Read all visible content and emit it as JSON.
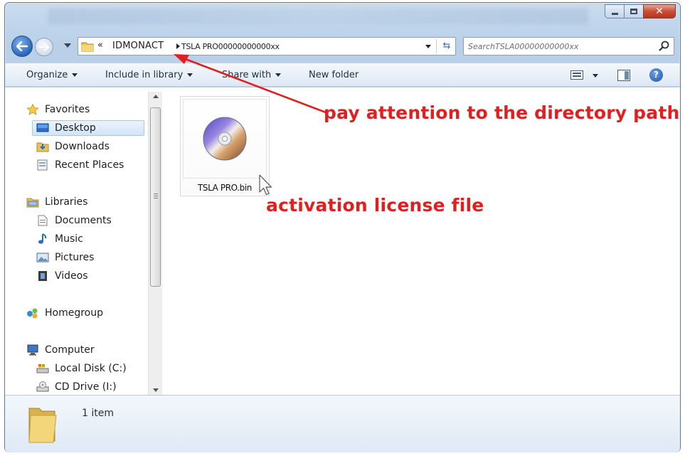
{
  "window": {
    "controls": {
      "minimize_icon": "minimize-icon",
      "maximize_icon": "maximize-icon",
      "close_icon": "close-icon"
    }
  },
  "navigation": {
    "address": {
      "overflow_glyph": "«",
      "segments": [
        "IDMONACT",
        "TSLA PRO00000000000xx"
      ]
    },
    "search": {
      "placeholder": "SearchTSLA00000000000xx"
    }
  },
  "toolbar": {
    "organize": "Organize",
    "include_in_library": "Include in library",
    "share_with": "Share with",
    "new_folder": "New folder"
  },
  "sidebar": {
    "favorites": {
      "label": "Favorites",
      "items": [
        "Desktop",
        "Downloads",
        "Recent Places"
      ]
    },
    "libraries": {
      "label": "Libraries",
      "items": [
        "Documents",
        "Music",
        "Pictures",
        "Videos"
      ]
    },
    "homegroup": {
      "label": "Homegroup"
    },
    "computer": {
      "label": "Computer",
      "items": [
        "Local Disk (C:)",
        "CD Drive (I:)"
      ]
    },
    "selected": "Desktop"
  },
  "files": [
    {
      "name": "TSLA PRO.bin",
      "icon": "disc-image-icon"
    }
  ],
  "status": {
    "item_count": "1 item"
  },
  "annotations": {
    "path_note": "pay attention to the directory path",
    "file_note": "activation license file",
    "color": "#e02020"
  },
  "colors": {
    "window_frame": "#b9d0e8",
    "selection": "#d3e5f9",
    "close_button": "#c64f35"
  }
}
